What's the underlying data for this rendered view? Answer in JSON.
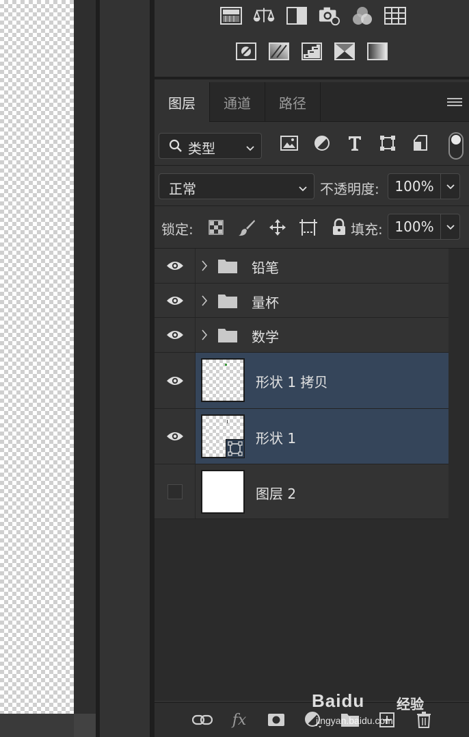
{
  "tabs": [
    {
      "label": "图层",
      "active": true
    },
    {
      "label": "通道",
      "active": false
    },
    {
      "label": "路径",
      "active": false
    }
  ],
  "filter": {
    "kind_label": "类型",
    "icons": [
      "image-filter-icon",
      "adjustment-filter-icon",
      "type-filter-icon",
      "shape-filter-icon",
      "smart-object-filter-icon"
    ]
  },
  "blend": {
    "mode": "正常",
    "opacity_label": "不透明度:",
    "opacity_value": "100%"
  },
  "lock": {
    "label": "锁定:",
    "fill_label": "填充:",
    "fill_value": "100%"
  },
  "layers": [
    {
      "name": "铅笔",
      "type": "group",
      "visible": true,
      "selected": false
    },
    {
      "name": "量杯",
      "type": "group",
      "visible": true,
      "selected": false
    },
    {
      "name": "数学",
      "type": "group",
      "visible": true,
      "selected": false
    },
    {
      "name": "形状 1 拷贝",
      "type": "shape",
      "visible": true,
      "selected": true
    },
    {
      "name": "形状 1",
      "type": "shape",
      "visible": true,
      "selected": true
    },
    {
      "name": "图层 2",
      "type": "pixel",
      "visible": false,
      "selected": false
    }
  ],
  "bottom_bar": {
    "fx_label": "fx"
  },
  "watermark": {
    "brand": "Baidu",
    "brand_suffix": "经验",
    "url": "jingyan.baidu.com"
  },
  "colors": {
    "panel_bg": "#323232",
    "selected_layer": "#35455a",
    "text": "#e2e2e2"
  }
}
